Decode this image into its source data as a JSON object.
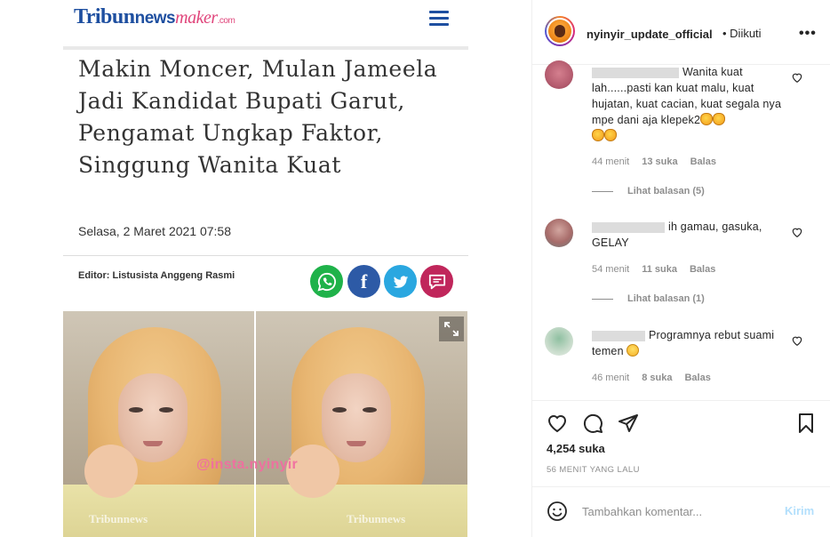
{
  "article": {
    "logo": {
      "tribun": "Tribun",
      "news": "news",
      "maker": "maker",
      "com": ".com"
    },
    "headline": "Makin Moncer, Mulan Jameela Jadi Kandidat Bupati Garut, Pengamat Ungkap Faktor, Singgung Wanita Kuat",
    "date": "Selasa, 2 Maret 2021 07:58",
    "editor": "Editor: Listusista Anggeng Rasmi",
    "share_icons": [
      "whatsapp-icon",
      "facebook-icon",
      "twitter-icon",
      "comment-icon"
    ],
    "watermark": "@insta.nyinyir",
    "photo_credit": "Tribunnews"
  },
  "instagram": {
    "username": "nyinyir_update_official",
    "follow_status": "• Diikuti",
    "more": "•••",
    "comments": [
      {
        "user_redacted": "xxxxxxxxxxxxxxxx",
        "text": "Wanita kuat lah......pasti kan kuat malu, kuat hujatan, kuat cacian, kuat segala nya mpe dani aja klepek2",
        "time": "44 menit",
        "likes": "13 suka",
        "reply": "Balas",
        "view_replies": "Lihat balasan (5)"
      },
      {
        "user_redacted": "xxxxxxxxxxxxxxxx",
        "text": "ih gamau, gasuka, GELAY",
        "time": "54 menit",
        "likes": "11 suka",
        "reply": "Balas",
        "view_replies": "Lihat balasan (1)"
      },
      {
        "user_redacted": "xxxxxxxxxxxx",
        "text": "Programnya rebut suami temen",
        "time": "46 menit",
        "likes": "8 suka",
        "reply": "Balas"
      }
    ],
    "likes_count": "4,254 suka",
    "timestamp": "56 MENIT YANG LALU",
    "comment_placeholder": "Tambahkan komentar...",
    "post_button": "Kirim",
    "colors": {
      "post_button_disabled": "#b2dffc",
      "meta_gray": "#8e8e8e",
      "text": "#262626"
    }
  }
}
